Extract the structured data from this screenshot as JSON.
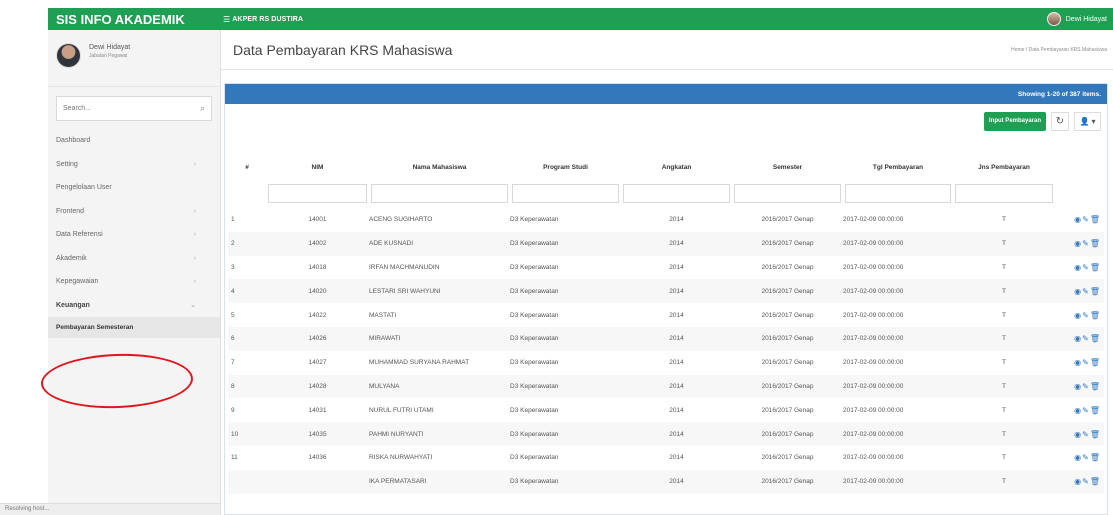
{
  "app": {
    "title": "SIS INFO AKADEMIK",
    "organization": "AKPER RS DUSTIRA",
    "current_user": "Dewi Hidayat"
  },
  "sidebar": {
    "profile_name": "Dewi Hidayat",
    "profile_role": "Jabatan Pegawai",
    "search_placeholder": "Search...",
    "items": [
      {
        "label": "Dashboard"
      },
      {
        "label": "Setting"
      },
      {
        "label": "Pengelolaan User"
      },
      {
        "label": "Frontend"
      },
      {
        "label": "Data Referensi"
      },
      {
        "label": "Akademik"
      },
      {
        "label": "Kepegawaian"
      },
      {
        "label": "Keuangan"
      }
    ],
    "submenu_label": "Pembayaran Semesteran",
    "loading_text": "Resolving host..."
  },
  "page": {
    "title": "Data Pembayaran KRS Mahasiswa",
    "breadcrumb": "Home / Data Pembayaran KRS Mahasiswa"
  },
  "table": {
    "summary": "Showing 1-20 of 387 items.",
    "input_button": "Input Pembayaran",
    "columns": [
      "#",
      "NIM",
      "Nama Mahasiswa",
      "Program Studi",
      "Angkatan",
      "Semester",
      "Tgl Pembayaran",
      "Jns Pembayaran",
      ""
    ],
    "rows": [
      {
        "num": "1",
        "nim": "14001",
        "nama": "ACENG SUGIHARTO",
        "prodi": "D3 Keperawatan",
        "angkatan": "2014",
        "semester": "2016/2017 Genap",
        "tgl": "2017-02-09 00:00:00",
        "jenis": "T"
      },
      {
        "num": "2",
        "nim": "14002",
        "nama": "ADE KUSNADI",
        "prodi": "D3 Keperawatan",
        "angkatan": "2014",
        "semester": "2016/2017 Genap",
        "tgl": "2017-02-09 00:00:00",
        "jenis": "T"
      },
      {
        "num": "3",
        "nim": "14018",
        "nama": "IRFAN MACHMANUDIN",
        "prodi": "D3 Keperawatan",
        "angkatan": "2014",
        "semester": "2016/2017 Genap",
        "tgl": "2017-02-09 00:00:00",
        "jenis": "T"
      },
      {
        "num": "4",
        "nim": "14020",
        "nama": "LESTARI SRI WAHYUNI",
        "prodi": "D3 Keperawatan",
        "angkatan": "2014",
        "semester": "2016/2017 Genap",
        "tgl": "2017-02-09 00:00:00",
        "jenis": "T"
      },
      {
        "num": "5",
        "nim": "14022",
        "nama": "MASTATI",
        "prodi": "D3 Keperawatan",
        "angkatan": "2014",
        "semester": "2016/2017 Genap",
        "tgl": "2017-02-09 00:00:00",
        "jenis": "T"
      },
      {
        "num": "6",
        "nim": "14026",
        "nama": "MIRAWATI",
        "prodi": "D3 Keperawatan",
        "angkatan": "2014",
        "semester": "2016/2017 Genap",
        "tgl": "2017-02-09 00:00:00",
        "jenis": "T"
      },
      {
        "num": "7",
        "nim": "14027",
        "nama": "MUHAMMAD SURYANA RAHMAT",
        "prodi": "D3 Keperawatan",
        "angkatan": "2014",
        "semester": "2016/2017 Genap",
        "tgl": "2017-02-09 00:00:00",
        "jenis": "T"
      },
      {
        "num": "8",
        "nim": "14028",
        "nama": "MULYANA",
        "prodi": "D3 Keperawatan",
        "angkatan": "2014",
        "semester": "2016/2017 Genap",
        "tgl": "2017-02-09 00:00:00",
        "jenis": "T"
      },
      {
        "num": "9",
        "nim": "14031",
        "nama": "NURUL FUTRI UTAMI",
        "prodi": "D3 Keperawatan",
        "angkatan": "2014",
        "semester": "2016/2017 Genap",
        "tgl": "2017-02-09 00:00:00",
        "jenis": "T"
      },
      {
        "num": "10",
        "nim": "14035",
        "nama": "PAHMI NURYANTI",
        "prodi": "D3 Keperawatan",
        "angkatan": "2014",
        "semester": "2016/2017 Genap",
        "tgl": "2017-02-09 00:00:00",
        "jenis": "T"
      },
      {
        "num": "11",
        "nim": "14036",
        "nama": "RISKA NURWAHYATI",
        "prodi": "D3 Keperawatan",
        "angkatan": "2014",
        "semester": "2016/2017 Genap",
        "tgl": "2017-02-09 00:00:00",
        "jenis": "T"
      },
      {
        "num": "",
        "nim": "",
        "nama": "IKA PERMATASARI",
        "prodi": "D3 Keperawatan",
        "angkatan": "2014",
        "semester": "2016/2017 Genap",
        "tgl": "2017-02-09 00:00:00",
        "jenis": "T"
      }
    ]
  },
  "colors": {
    "green": "#1f9f53",
    "blue": "#3478bc",
    "highlight_red": "#e0161e"
  }
}
